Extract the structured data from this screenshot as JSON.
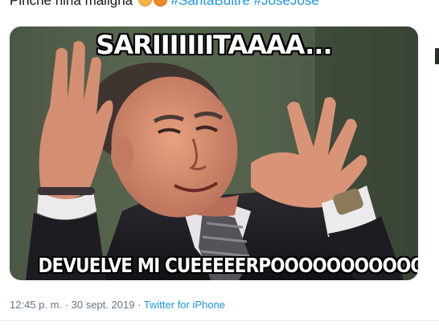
{
  "tweet": {
    "text": "Pinche niña maligna",
    "emojis": [
      "smiling-face-emoji",
      "devil-emoji"
    ],
    "hashtags": [
      "#SantaBuitre",
      "#JoseJose"
    ]
  },
  "media": {
    "caption_top": "SARIIIIIIITAAAA...",
    "caption_bottom": "DEVUELVE MI CUEEEEERPOOOOOOOOOOOO...."
  },
  "meta": {
    "time": "12:45 p. m.",
    "separator": "·",
    "date": "30 sept. 2019",
    "source": "Twitter for iPhone"
  },
  "colors": {
    "link": "#1b95e0",
    "text": "#14171a",
    "muted": "#657786"
  }
}
